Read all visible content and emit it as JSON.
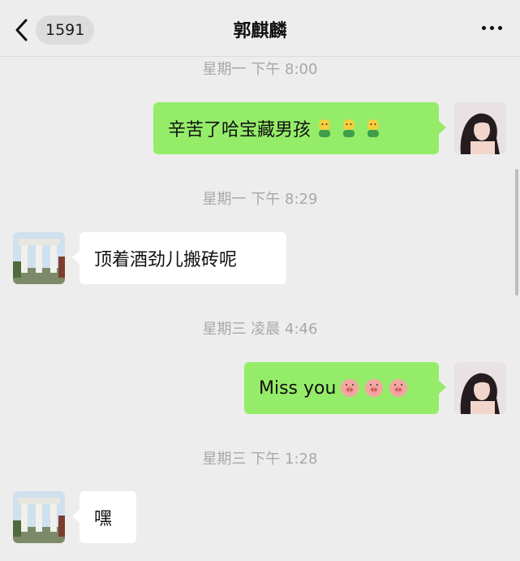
{
  "header": {
    "unread_count": "1591",
    "title": "郭麒麟",
    "back_icon": "chevron-left-icon",
    "more_icon": "more-dots-icon"
  },
  "colors": {
    "outgoing_bubble": "#95ec69",
    "incoming_bubble": "#ffffff",
    "background": "#ededed",
    "timestamp": "#a8a8a8"
  },
  "messages": [
    {
      "timestamp": "星期一 下午 8:00",
      "direction": "out",
      "text": "辛苦了哈宝藏男孩",
      "emoji": [
        "person-emoji",
        "person-emoji",
        "person-emoji"
      ]
    },
    {
      "timestamp": "星期一 下午 8:29",
      "direction": "in",
      "text": "顶着酒劲儿搬砖呢",
      "emoji": []
    },
    {
      "timestamp": "星期三 凌晨 4:46",
      "direction": "out",
      "text": "Miss you",
      "emoji": [
        "pig-emoji",
        "pig-emoji",
        "pig-emoji"
      ]
    },
    {
      "timestamp": "星期三 下午 1:28",
      "direction": "in",
      "text": "嘿",
      "emoji": []
    }
  ]
}
